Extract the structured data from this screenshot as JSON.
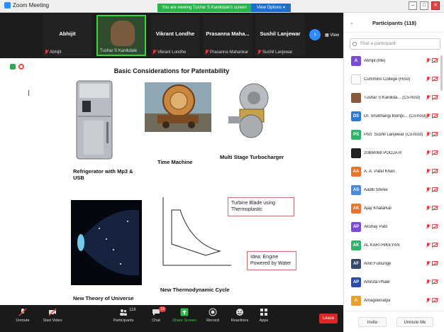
{
  "window": {
    "title": "Zoom Meeting",
    "viewing_banner": "You are viewing Tushar S Kanikdale's screen",
    "view_options": "View Options"
  },
  "strip": {
    "tiles": [
      {
        "name": "Abhijit",
        "label": "Abhijit"
      },
      {
        "name": "",
        "label": "Tushar S Kanikdale"
      },
      {
        "name": "Vikrant Londhe",
        "label": "Vikrant Londhe"
      },
      {
        "name": "Prasanna Maha...",
        "label": "Prasanna Mahankar"
      },
      {
        "name": "Sushil Lanjewar",
        "label": "Sushil Lanjewar"
      }
    ],
    "view_label": "View"
  },
  "slide": {
    "title": "Basic Considerations for Patentability",
    "captions": {
      "refrigerator": "Refrigerator with Mp3 & USB",
      "time_machine": "Time Machine",
      "turbocharger": "Multi Stage Turbocharger",
      "universe": "New Theory of Universe",
      "thermo": "New Thermodynamic Cycle"
    },
    "notes": {
      "turbine": "Turbine Blade using Thermoplastic",
      "engine": "Idea: Engine Powered by Water"
    }
  },
  "toolbar": {
    "unmute": "Unmute",
    "start_video": "Start Video",
    "participants": "Participants",
    "participants_count": "116",
    "chat": "Chat",
    "chat_badge": "18",
    "share": "Share Screen",
    "record": "Record",
    "reactions": "Reactions",
    "apps": "Apps",
    "leave": "Leave"
  },
  "panel": {
    "title": "Participants (118)",
    "search_placeholder": "Find a participant",
    "participants": [
      {
        "initials": "A",
        "name": "Abhijit (Me)",
        "color": "#7b4bd8"
      },
      {
        "initials": "",
        "name": "Cummins College (Host)",
        "color": "#ffffff"
      },
      {
        "initials": "",
        "name": "Tushar S Kanikda... (Co-host)",
        "color": "#8a5a3a"
      },
      {
        "initials": "DS",
        "name": "Dr. Shubhangi Bompi... (Co-host)",
        "color": "#2d7ad6"
      },
      {
        "initials": "PS",
        "name": "Prof. Sushil Lanjewar (Co-host)",
        "color": "#2fb36a"
      },
      {
        "initials": "",
        "name": "20BM068 POOJA R",
        "color": "#222222"
      },
      {
        "initials": "AA",
        "name": "A. A. Patel Khan",
        "color": "#e8742a"
      },
      {
        "initials": "AS",
        "name": "Aaditi Shirke",
        "color": "#4a8be0"
      },
      {
        "initials": "AK",
        "name": "Ajay Khatarkar",
        "color": "#e8742a"
      },
      {
        "initials": "AP",
        "name": "Akshay Patil",
        "color": "#7b4bd8"
      },
      {
        "initials": "AK",
        "name": "AL KARTHIKEYAN",
        "color": "#2fb36a"
      },
      {
        "initials": "AF",
        "name": "Amit Fulsunge",
        "color": "#3a4a6a"
      },
      {
        "initials": "AP",
        "name": "Amruta Phale",
        "color": "#2d4aa8"
      },
      {
        "initials": "A",
        "name": "Amagowsalya",
        "color": "#e8a02a"
      }
    ],
    "invite": "Invite",
    "unmute_me": "Unmute Me"
  }
}
